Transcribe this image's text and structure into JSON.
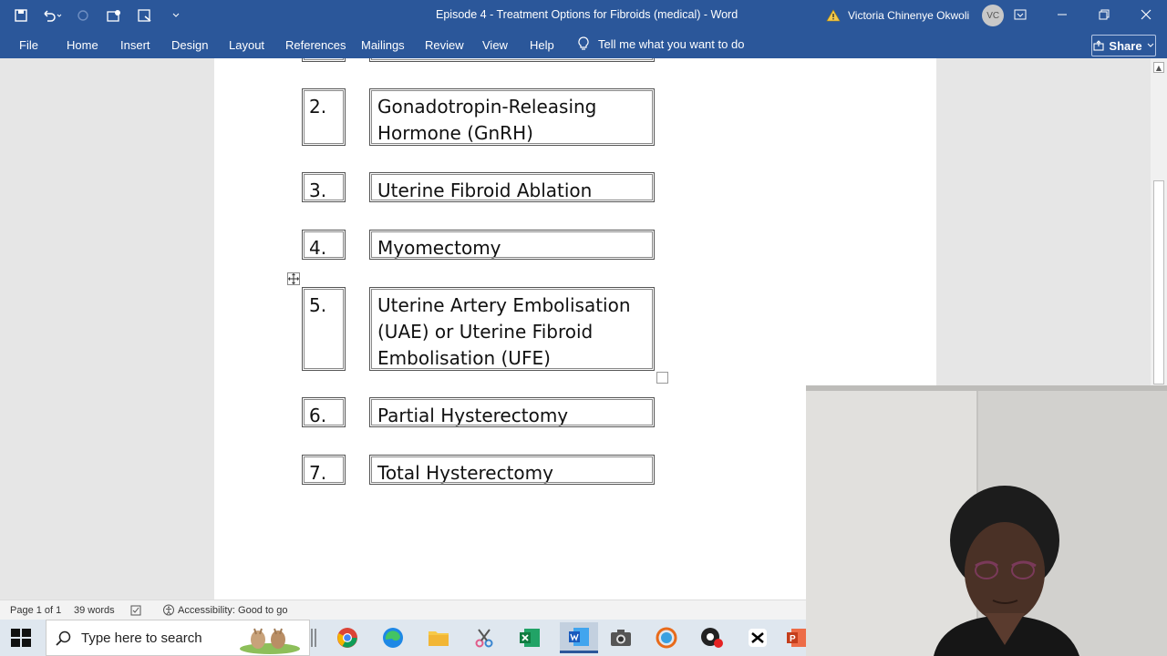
{
  "window": {
    "title": "Episode 4 - Treatment Options for Fibroids (medical)  -  Word",
    "user_name": "Victoria Chinenye Okwoli",
    "avatar_initials": "VC"
  },
  "ribbon": {
    "tabs": [
      "File",
      "Home",
      "Insert",
      "Design",
      "Layout",
      "References",
      "Mailings",
      "Review",
      "View",
      "Help"
    ],
    "tell_me": "Tell me what you want to do",
    "share": "Share"
  },
  "document": {
    "rows": [
      {
        "num": "2.",
        "text": "Gonadotropin-Releasing Hormone (GnRH)"
      },
      {
        "num": "3.",
        "text": "Uterine Fibroid Ablation"
      },
      {
        "num": "4.",
        "text": "Myomectomy"
      },
      {
        "num": "5.",
        "text": "Uterine Artery Embolisation (UAE) or Uterine Fibroid Embolisation (UFE)"
      },
      {
        "num": "6.",
        "text": "Partial Hysterectomy"
      },
      {
        "num": "7.",
        "text": "Total Hysterectomy"
      }
    ]
  },
  "status": {
    "page": "Page 1 of 1",
    "words": "39 words",
    "accessibility": "Accessibility: Good to go"
  },
  "taskbar": {
    "search_placeholder": "Type here to search"
  },
  "icons": {
    "warning_color": "#f2c94c",
    "titlebar_color": "#2b579a"
  }
}
